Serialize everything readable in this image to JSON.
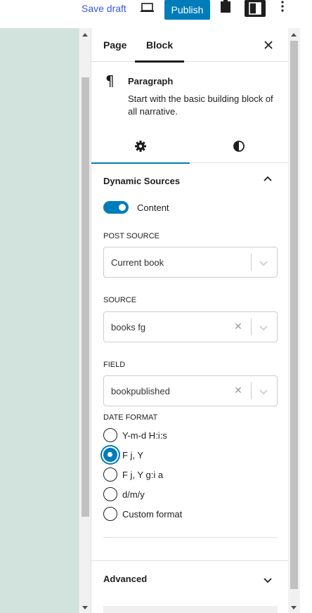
{
  "toolbar": {
    "save_draft": "Save draft",
    "publish": "Publish"
  },
  "sidebar": {
    "tabs": {
      "page": "Page",
      "block": "Block"
    },
    "block": {
      "title": "Paragraph",
      "description": "Start with the basic building block of all narrative."
    },
    "dynamic_sources": {
      "title": "Dynamic Sources",
      "toggle_label": "Content",
      "toggle_on": true,
      "post_source": {
        "label": "POST SOURCE",
        "value": "Current book"
      },
      "source": {
        "label": "SOURCE",
        "value": "books fg"
      },
      "field": {
        "label": "FIELD",
        "value": "bookpublished"
      },
      "date_format": {
        "label": "DATE FORMAT",
        "options": [
          "Y-m-d H:i:s",
          "F j, Y",
          "F j, Y g:i a",
          "d/m/y",
          "Custom format"
        ],
        "selected": "F j, Y"
      }
    },
    "advanced": {
      "title": "Advanced"
    }
  },
  "colors": {
    "accent": "#007cba",
    "link": "#3858e9",
    "canvas": "#d2e3dd"
  }
}
